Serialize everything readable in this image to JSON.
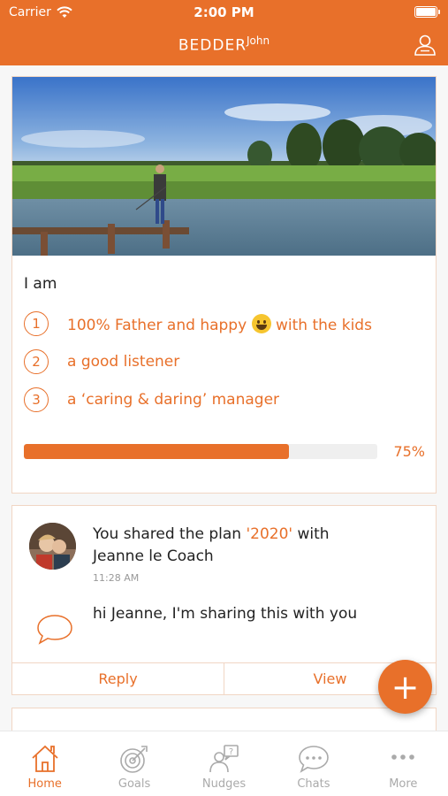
{
  "status_bar": {
    "carrier": "Carrier",
    "time": "2:00 PM"
  },
  "nav": {
    "title": "BEDDER",
    "title_sup": "John"
  },
  "iam_card": {
    "label": "I am",
    "goals": [
      {
        "num": "1",
        "text_before": "100% Father and happy",
        "emoji": "grinning-face",
        "text_after": "with the kids"
      },
      {
        "num": "2",
        "text": "a good listener"
      },
      {
        "num": "3",
        "text": "a ‘caring & daring’ manager"
      }
    ],
    "progress_pct": 75,
    "progress_label": "75%"
  },
  "share_card": {
    "line_before": "You shared the plan",
    "plan_name": "'2020'",
    "line_after": "with",
    "recipient": "Jeanne le Coach",
    "time": "11:28 AM",
    "message": "hi Jeanne, I'm sharing this with you",
    "reply_label": "Reply",
    "view_label": "View"
  },
  "fab": {
    "label": "+"
  },
  "tab_bar": {
    "items": [
      {
        "label": "Home",
        "icon": "house-icon",
        "active": true
      },
      {
        "label": "Goals",
        "icon": "target-icon",
        "active": false
      },
      {
        "label": "Nudges",
        "icon": "nudges-icon",
        "active": false
      },
      {
        "label": "Chats",
        "icon": "chat-icon",
        "active": false
      },
      {
        "label": "More",
        "icon": "more-icon",
        "active": false
      }
    ]
  },
  "colors": {
    "accent": "#e8702a",
    "inactive": "#aaaaaa",
    "border": "#f1d6c4"
  }
}
